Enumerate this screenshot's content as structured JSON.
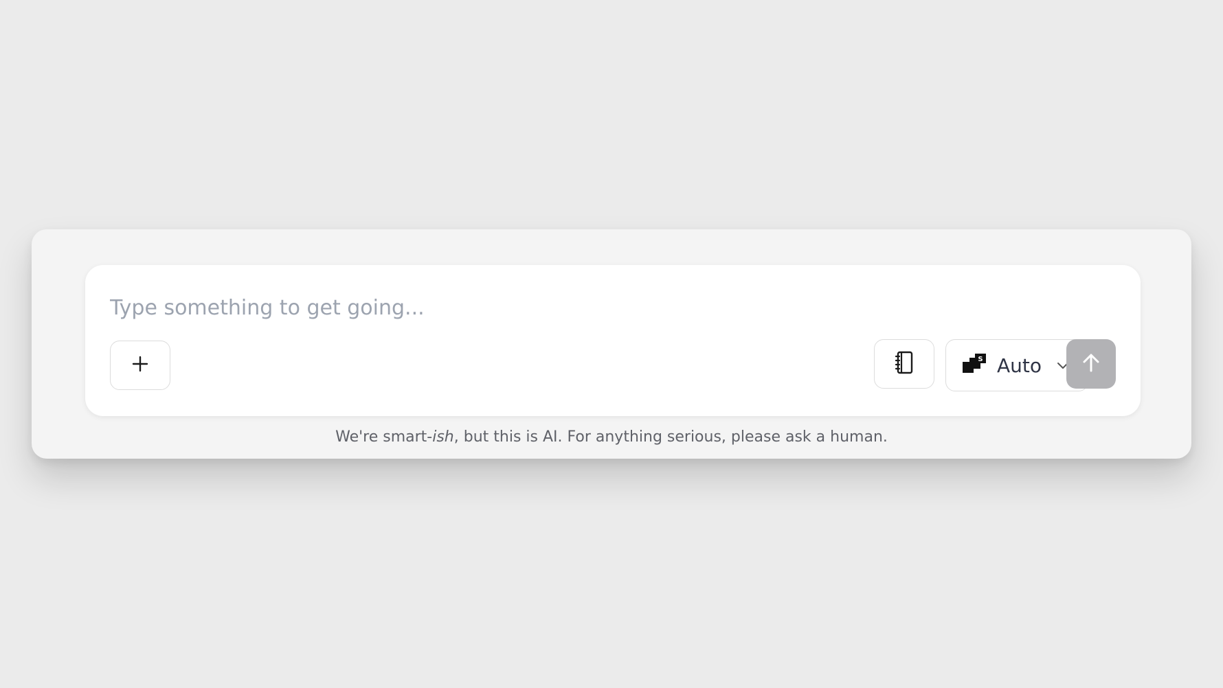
{
  "composer": {
    "placeholder": "Type something to get going...",
    "value": ""
  },
  "toolbar": {
    "attach_icon": "plus-icon",
    "notebook_icon": "notebook-icon",
    "model_icon": "model-logo-icon",
    "model_label": "Auto",
    "chevron_icon": "chevron-down-icon",
    "send_icon": "arrow-up-icon"
  },
  "disclaimer": {
    "prefix": "We're smart-",
    "emphasis": "ish",
    "suffix": ", but this is AI. For anything serious, please ask a human."
  },
  "colors": {
    "background": "#ebebeb",
    "panel": "#f4f4f4",
    "composer": "#ffffff",
    "send_button": "#b2b2b5",
    "placeholder": "#9ca3af",
    "disclaimer_text": "#5f6168"
  }
}
